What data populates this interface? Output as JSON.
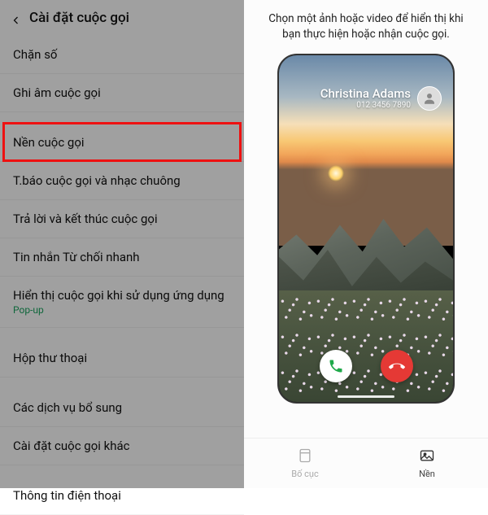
{
  "left": {
    "title": "Cài đặt cuộc gọi",
    "items": [
      {
        "label": "Chặn số"
      },
      {
        "label": "Ghi âm cuộc gọi"
      },
      {
        "label": "Nền cuộc gọi",
        "highlighted": true
      },
      {
        "label": "T.báo cuộc gọi và nhạc chuông"
      },
      {
        "label": "Trả lời và kết thúc cuộc gọi"
      },
      {
        "label": "Tin nhắn Từ chối nhanh"
      },
      {
        "label": "Hiển thị cuộc gọi khi sử dụng ứng dụng",
        "sub": "Pop-up"
      },
      {
        "label": "Hộp thư thoại"
      },
      {
        "label": "Các dịch vụ bổ sung"
      },
      {
        "label": "Cài đặt cuộc gọi khác"
      },
      {
        "label": "Thông tin điện thoại"
      }
    ]
  },
  "right": {
    "desc": "Chọn một ảnh hoặc video để hiển thị khi bạn thực hiện hoặc nhận cuộc gọi.",
    "caller_name": "Christina Adams",
    "caller_number": "012 3456 7890",
    "nav": {
      "layout": "Bố cục",
      "background": "Nền"
    }
  }
}
